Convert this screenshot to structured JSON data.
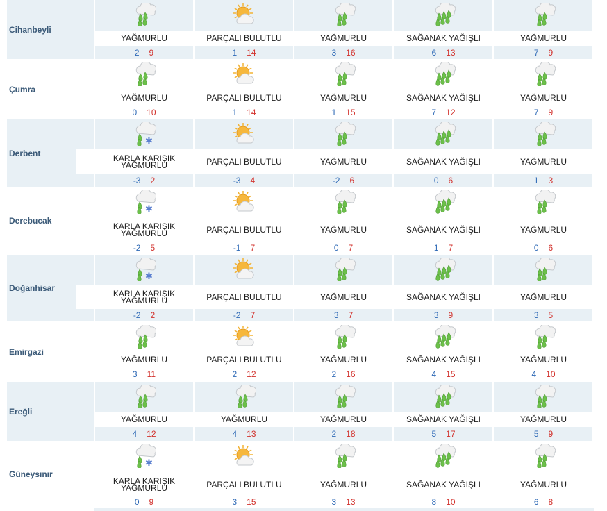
{
  "rows": [
    {
      "city": "Cihanbeyli",
      "days": [
        {
          "icon": "rain-icon",
          "condition": "YAĞMURLU",
          "min": "2",
          "max": "9"
        },
        {
          "icon": "partly-cloudy-icon",
          "condition": "PARÇALI BULUTLU",
          "min": "1",
          "max": "14"
        },
        {
          "icon": "rain-icon",
          "condition": "YAĞMURLU",
          "min": "3",
          "max": "16"
        },
        {
          "icon": "shower-icon",
          "condition": "SAĞANAK YAĞIŞLI",
          "min": "6",
          "max": "13"
        },
        {
          "icon": "rain-icon",
          "condition": "YAĞMURLU",
          "min": "7",
          "max": "9"
        }
      ]
    },
    {
      "city": "Çumra",
      "days": [
        {
          "icon": "rain-icon",
          "condition": "YAĞMURLU",
          "min": "0",
          "max": "10"
        },
        {
          "icon": "partly-cloudy-icon",
          "condition": "PARÇALI BULUTLU",
          "min": "1",
          "max": "14"
        },
        {
          "icon": "rain-icon",
          "condition": "YAĞMURLU",
          "min": "1",
          "max": "15"
        },
        {
          "icon": "shower-icon",
          "condition": "SAĞANAK YAĞIŞLI",
          "min": "7",
          "max": "12"
        },
        {
          "icon": "rain-icon",
          "condition": "YAĞMURLU",
          "min": "7",
          "max": "9"
        }
      ]
    },
    {
      "city": "Derbent",
      "days": [
        {
          "icon": "sleet-icon",
          "condition": "KARLA KARIŞIK YAĞMURLU",
          "min": "-3",
          "max": "2"
        },
        {
          "icon": "partly-cloudy-icon",
          "condition": "PARÇALI BULUTLU",
          "min": "-3",
          "max": "4"
        },
        {
          "icon": "rain-icon",
          "condition": "YAĞMURLU",
          "min": "-2",
          "max": "6"
        },
        {
          "icon": "shower-icon",
          "condition": "SAĞANAK YAĞIŞLI",
          "min": "0",
          "max": "6"
        },
        {
          "icon": "rain-icon",
          "condition": "YAĞMURLU",
          "min": "1",
          "max": "3"
        }
      ]
    },
    {
      "city": "Derebucak",
      "days": [
        {
          "icon": "sleet-icon",
          "condition": "KARLA KARIŞIK YAĞMURLU",
          "min": "-2",
          "max": "5"
        },
        {
          "icon": "partly-cloudy-icon",
          "condition": "PARÇALI BULUTLU",
          "min": "-1",
          "max": "7"
        },
        {
          "icon": "rain-icon",
          "condition": "YAĞMURLU",
          "min": "0",
          "max": "7"
        },
        {
          "icon": "shower-icon",
          "condition": "SAĞANAK YAĞIŞLI",
          "min": "1",
          "max": "7"
        },
        {
          "icon": "rain-icon",
          "condition": "YAĞMURLU",
          "min": "0",
          "max": "6"
        }
      ]
    },
    {
      "city": "Doğanhisar",
      "days": [
        {
          "icon": "sleet-icon",
          "condition": "KARLA KARIŞIK YAĞMURLU",
          "min": "-2",
          "max": "2"
        },
        {
          "icon": "partly-cloudy-icon",
          "condition": "PARÇALI BULUTLU",
          "min": "-2",
          "max": "7"
        },
        {
          "icon": "rain-icon",
          "condition": "YAĞMURLU",
          "min": "3",
          "max": "7"
        },
        {
          "icon": "shower-icon",
          "condition": "SAĞANAK YAĞIŞLI",
          "min": "3",
          "max": "9"
        },
        {
          "icon": "rain-icon",
          "condition": "YAĞMURLU",
          "min": "3",
          "max": "5"
        }
      ]
    },
    {
      "city": "Emirgazi",
      "days": [
        {
          "icon": "rain-icon",
          "condition": "YAĞMURLU",
          "min": "3",
          "max": "11"
        },
        {
          "icon": "partly-cloudy-icon",
          "condition": "PARÇALI BULUTLU",
          "min": "2",
          "max": "12"
        },
        {
          "icon": "rain-icon",
          "condition": "YAĞMURLU",
          "min": "2",
          "max": "16"
        },
        {
          "icon": "shower-icon",
          "condition": "SAĞANAK YAĞIŞLI",
          "min": "4",
          "max": "15"
        },
        {
          "icon": "rain-icon",
          "condition": "YAĞMURLU",
          "min": "4",
          "max": "10"
        }
      ]
    },
    {
      "city": "Ereğli",
      "days": [
        {
          "icon": "rain-icon",
          "condition": "YAĞMURLU",
          "min": "4",
          "max": "12"
        },
        {
          "icon": "rain-icon",
          "condition": "YAĞMURLU",
          "min": "4",
          "max": "13"
        },
        {
          "icon": "rain-icon",
          "condition": "YAĞMURLU",
          "min": "2",
          "max": "18"
        },
        {
          "icon": "shower-icon",
          "condition": "SAĞANAK YAĞIŞLI",
          "min": "5",
          "max": "17"
        },
        {
          "icon": "rain-icon",
          "condition": "YAĞMURLU",
          "min": "5",
          "max": "9"
        }
      ]
    },
    {
      "city": "Güneysınır",
      "days": [
        {
          "icon": "sleet-icon",
          "condition": "KARLA KARIŞIK YAĞMURLU",
          "min": "0",
          "max": "9"
        },
        {
          "icon": "partly-cloudy-icon",
          "condition": "PARÇALI BULUTLU",
          "min": "3",
          "max": "15"
        },
        {
          "icon": "rain-icon",
          "condition": "YAĞMURLU",
          "min": "3",
          "max": "13"
        },
        {
          "icon": "shower-icon",
          "condition": "SAĞANAK YAĞIŞLI",
          "min": "8",
          "max": "10"
        },
        {
          "icon": "rain-icon",
          "condition": "YAĞMURLU",
          "min": "6",
          "max": "8"
        }
      ]
    }
  ]
}
